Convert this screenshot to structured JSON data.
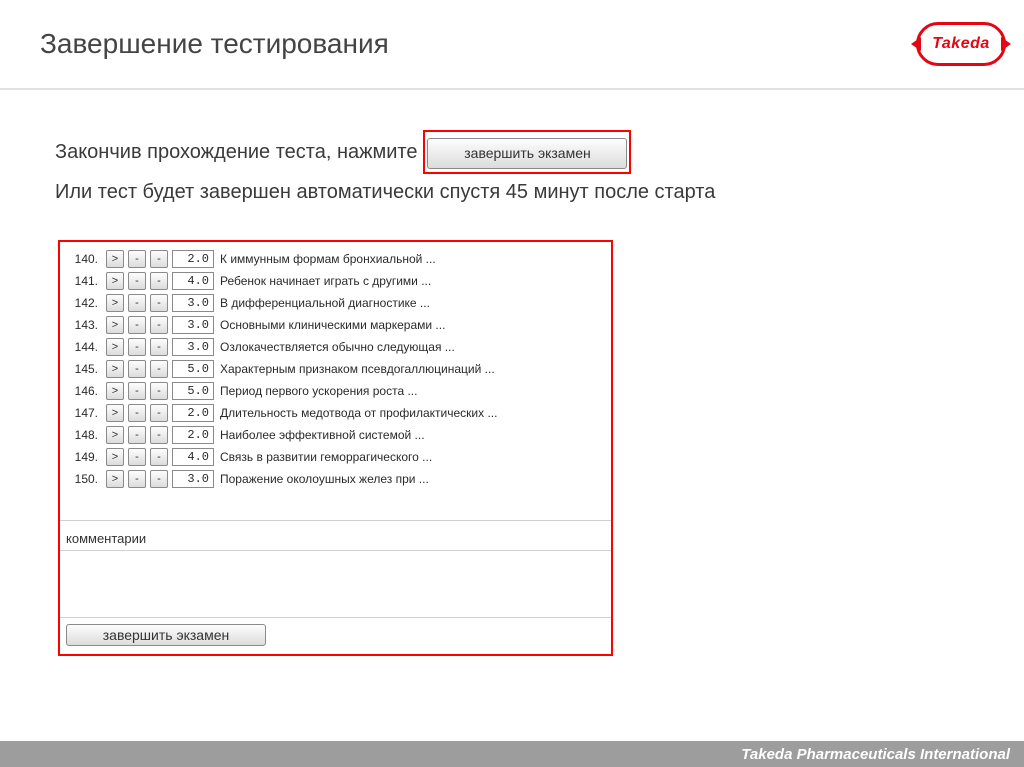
{
  "header": {
    "title": "Завершение тестирования",
    "logo_text": "Takeda"
  },
  "body": {
    "line1_prefix": "Закончив прохождение теста, нажмите",
    "finish_button_label": "завершить экзамен",
    "line2": "Или тест будет завершен автоматически спустя 45 минут после старта"
  },
  "panel": {
    "questions": [
      {
        "num": "140.",
        "score": "2.0",
        "text": "К иммунным формам бронхиальной ..."
      },
      {
        "num": "141.",
        "score": "4.0",
        "text": "Ребенок начинает играть с другими ..."
      },
      {
        "num": "142.",
        "score": "3.0",
        "text": "В дифференциальной диагностике ..."
      },
      {
        "num": "143.",
        "score": "3.0",
        "text": "Основными клиническими маркерами ..."
      },
      {
        "num": "144.",
        "score": "3.0",
        "text": "Озлокачествляется обычно следующая ..."
      },
      {
        "num": "145.",
        "score": "5.0",
        "text": "Характерным признаком псевдогаллюцинаций ..."
      },
      {
        "num": "146.",
        "score": "5.0",
        "text": "Период первого ускорения роста ..."
      },
      {
        "num": "147.",
        "score": "2.0",
        "text": "Длительность медотвода от профилактических ..."
      },
      {
        "num": "148.",
        "score": "2.0",
        "text": "Наиболее эффективной системой ..."
      },
      {
        "num": "149.",
        "score": "4.0",
        "text": "Связь в развитии геморрагического ..."
      },
      {
        "num": "150.",
        "score": "3.0",
        "text": "Поражение околоушных желез при ..."
      }
    ],
    "row_buttons": {
      "go": ">",
      "minus1": "-",
      "minus2": "-"
    },
    "comments_label": "комментарии",
    "finish_bottom_label": "завершить экзамен"
  },
  "footer": {
    "text": "Takeda Pharmaceuticals International"
  }
}
